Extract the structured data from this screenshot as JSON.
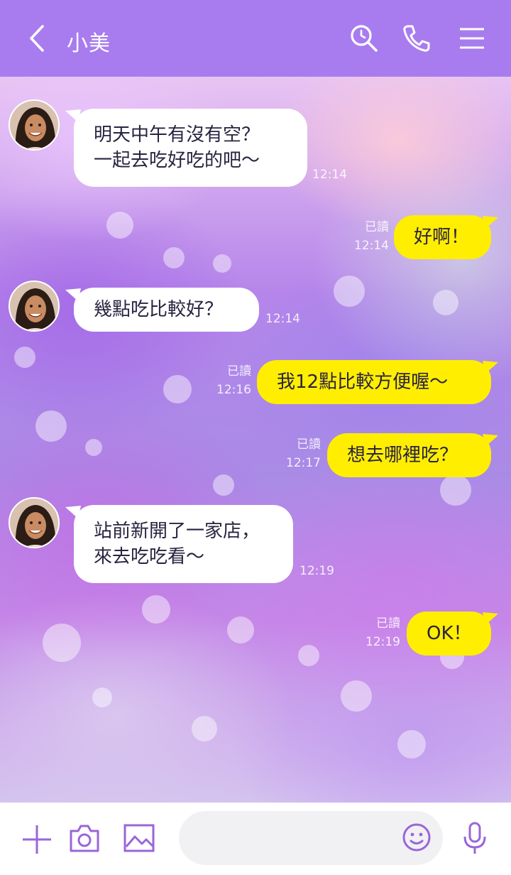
{
  "header": {
    "title": "小美",
    "back_icon": "chevron-left-icon",
    "search_icon": "search-icon",
    "phone_icon": "phone-icon",
    "menu_icon": "menu-icon"
  },
  "messages": [
    {
      "side": "in",
      "lines": [
        "明天中午有沒有空？",
        "一起去吃好吃的吧～"
      ],
      "time": "12:14"
    },
    {
      "side": "out",
      "lines": [
        "好啊！"
      ],
      "read": "已讀",
      "time": "12:14"
    },
    {
      "side": "in",
      "lines": [
        "幾點吃比較好？"
      ],
      "time": "12:14"
    },
    {
      "side": "out",
      "lines": [
        "我12點比較方便喔～"
      ],
      "read": "已讀",
      "time": "12:16"
    },
    {
      "side": "out",
      "lines": [
        "想去哪裡吃？"
      ],
      "read": "已讀",
      "time": "12:17"
    },
    {
      "side": "in",
      "lines": [
        "站前新開了一家店，",
        "來去吃吃看～"
      ],
      "time": "12:19"
    },
    {
      "side": "out",
      "lines": [
        "OK！"
      ],
      "read": "已讀",
      "time": "12:19"
    }
  ],
  "input_bar": {
    "plus_icon": "plus-icon",
    "camera_icon": "camera-icon",
    "image_icon": "image-icon",
    "message_value": "",
    "emoji_icon": "emoji-icon",
    "mic_icon": "microphone-icon"
  },
  "colors": {
    "header": "#a87cef",
    "outgoing_bubble": "#ffee00",
    "incoming_bubble": "#ffffff",
    "icon_purple": "#9a66d8"
  }
}
